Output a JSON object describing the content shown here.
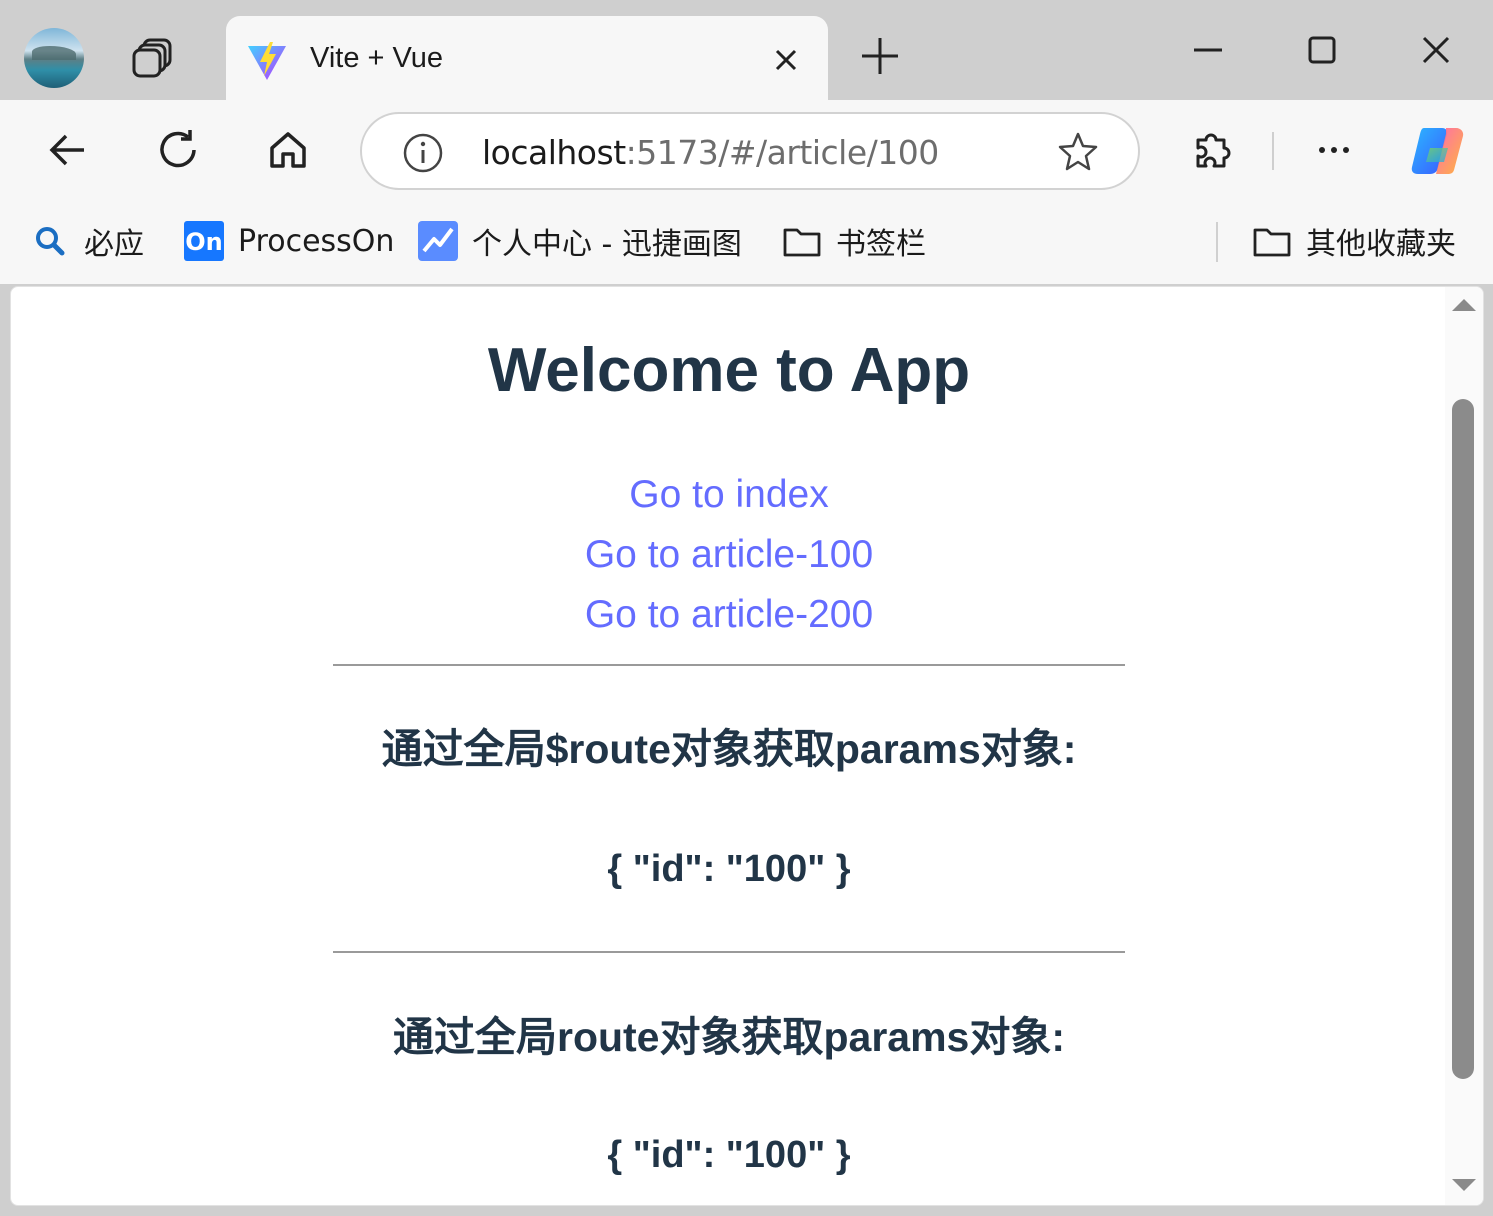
{
  "browser": {
    "tab": {
      "title": "Vite + Vue"
    },
    "address": {
      "host": "localhost",
      "rest": ":5173/#/article/100"
    },
    "bookmarks": [
      {
        "label": "必应"
      },
      {
        "label": "ProcessOn"
      },
      {
        "label": "个人中心 - 迅捷画图"
      },
      {
        "label": "书签栏"
      }
    ],
    "other_bookmarks": "其他收藏夹"
  },
  "page": {
    "title": "Welcome to App",
    "links": [
      {
        "label": "Go to index"
      },
      {
        "label": "Go to article-100"
      },
      {
        "label": "Go to article-200"
      }
    ],
    "section1": {
      "heading": "通过全局$route对象获取params对象:",
      "value": "{ \"id\": \"100\" }"
    },
    "section2": {
      "heading": "通过全局route对象获取params对象:",
      "value": "{ \"id\": \"100\" }"
    }
  },
  "colors": {
    "link": "#646cff",
    "text": "#213547",
    "chrome": "#f7f7f7",
    "tabstrip": "#cfcfcf"
  }
}
